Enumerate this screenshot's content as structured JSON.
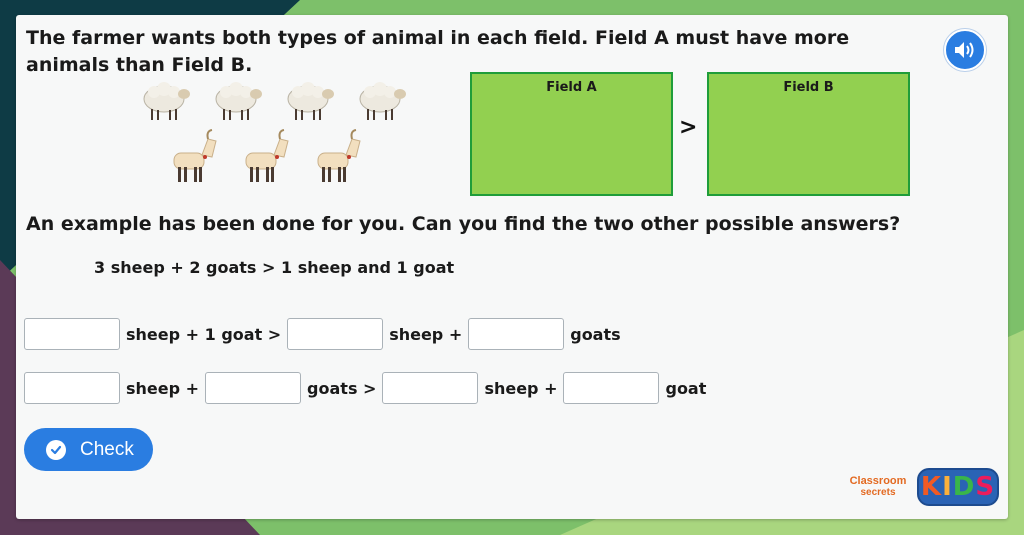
{
  "colors": {
    "accent": "#2a7de1",
    "field_fill": "#92d050",
    "field_border": "#1f9d3a",
    "background_green": "#7dc06a",
    "background_dark": "#0e3b45",
    "background_purple": "#5b3a57"
  },
  "question": "The farmer wants both types of animal in each field. Field A must have more animals than Field B.",
  "audio_icon": "speaker-icon",
  "animals": {
    "sheep_count": 4,
    "goat_count": 3
  },
  "fields": {
    "a_label": "Field A",
    "comparison": ">",
    "b_label": "Field B"
  },
  "instruction": "An example has been done for you. Can you find the two other possible answers?",
  "example": "3 sheep + 2 goats > 1 sheep and 1 goat",
  "row1": {
    "t1": "sheep + 1 goat >",
    "t2": "sheep +",
    "t3": "goats"
  },
  "row2": {
    "t1": "sheep +",
    "t2": "goats >",
    "t3": "sheep +",
    "t4": "goat"
  },
  "check_button": {
    "label": "Check",
    "icon": "check-circle-icon"
  },
  "logo": {
    "line1": "Classroom",
    "line2": "secrets",
    "kids_k": "K",
    "kids_i": "I",
    "kids_d": "D",
    "kids_s": "S"
  }
}
